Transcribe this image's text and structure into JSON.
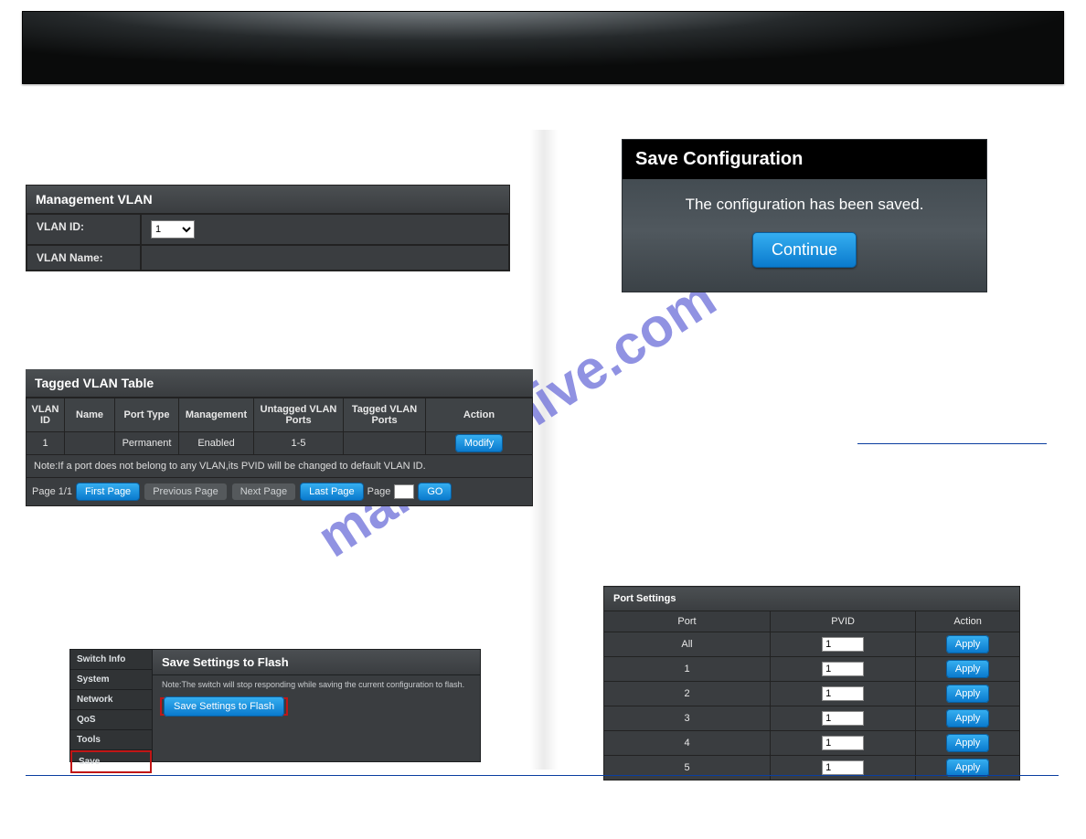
{
  "watermark": "manualshive.com",
  "mgmt_vlan": {
    "title": "Management VLAN",
    "vlan_id_label": "VLAN ID:",
    "vlan_id_value": "1",
    "vlan_name_label": "VLAN Name:",
    "vlan_name_value": ""
  },
  "save_conf": {
    "title": "Save Configuration",
    "message": "The configuration has been saved.",
    "continue": "Continue"
  },
  "tvlan": {
    "title": "Tagged VLAN Table",
    "headers": {
      "id": "VLAN ID",
      "name": "Name",
      "ptype": "Port Type",
      "mgmt": "Management",
      "untagged": "Untagged VLAN Ports",
      "tagged": "Tagged VLAN Ports",
      "action": "Action"
    },
    "row": {
      "id": "1",
      "name": "",
      "ptype": "Permanent",
      "mgmt": "Enabled",
      "untagged": "1-5",
      "tagged": "",
      "action": "Modify"
    },
    "note": "Note:If a port does not belong to any VLAN,its PVID will be changed to default VLAN ID.",
    "pager": {
      "page_label": "Page 1/1",
      "first": "First Page",
      "prev": "Previous Page",
      "next": "Next Page",
      "last": "Last Page",
      "page_word": "Page",
      "page_value": "",
      "go": "GO"
    }
  },
  "flash": {
    "side": {
      "switch_info": "Switch Info",
      "system": "System",
      "network": "Network",
      "qos": "QoS",
      "tools": "Tools",
      "save": "Save"
    },
    "title": "Save Settings to Flash",
    "note": "Note:The switch will stop responding while saving the current configuration to flash.",
    "button": "Save Settings to Flash"
  },
  "port_settings": {
    "title": "Port Settings",
    "headers": {
      "port": "Port",
      "pvid": "PVID",
      "action": "Action"
    },
    "rows": [
      {
        "port": "All",
        "pvid": "1",
        "action": "Apply"
      },
      {
        "port": "1",
        "pvid": "1",
        "action": "Apply"
      },
      {
        "port": "2",
        "pvid": "1",
        "action": "Apply"
      },
      {
        "port": "3",
        "pvid": "1",
        "action": "Apply"
      },
      {
        "port": "4",
        "pvid": "1",
        "action": "Apply"
      },
      {
        "port": "5",
        "pvid": "1",
        "action": "Apply"
      }
    ]
  }
}
